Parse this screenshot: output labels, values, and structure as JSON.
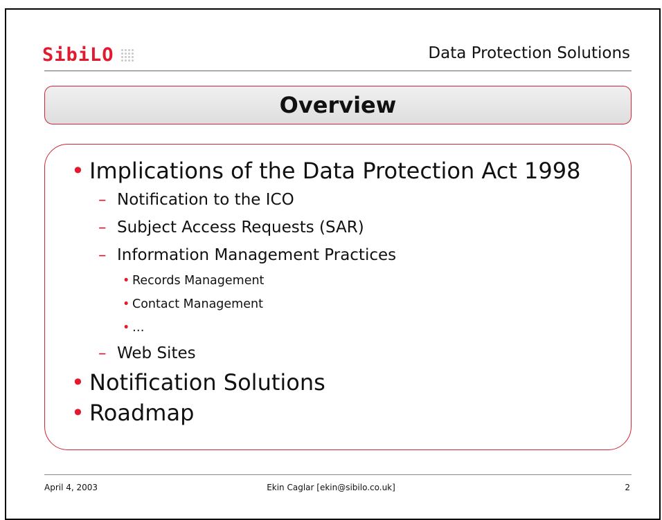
{
  "header": {
    "logo_text": "SibiLO",
    "tagline": "Data Protection Solutions"
  },
  "slide": {
    "title": "Overview",
    "items": [
      {
        "label": "Implications of the Data Protection Act 1998"
      },
      {
        "label": "Notification to the ICO"
      },
      {
        "label": "Subject Access Requests (SAR)"
      },
      {
        "label": "Information Management Practices"
      },
      {
        "label": "Records Management"
      },
      {
        "label": "Contact Management"
      },
      {
        "label": "…"
      },
      {
        "label": "Web Sites"
      },
      {
        "label": "Notification Solutions"
      },
      {
        "label": "Roadmap"
      }
    ]
  },
  "footer": {
    "date": "April 4, 2003",
    "author": "Ekin Caglar [ekin@sibilo.co.uk]",
    "page_number": "2"
  },
  "colors": {
    "accent": "#e3192e",
    "border": "#d02436",
    "title_bg": "#e6e6e6"
  }
}
